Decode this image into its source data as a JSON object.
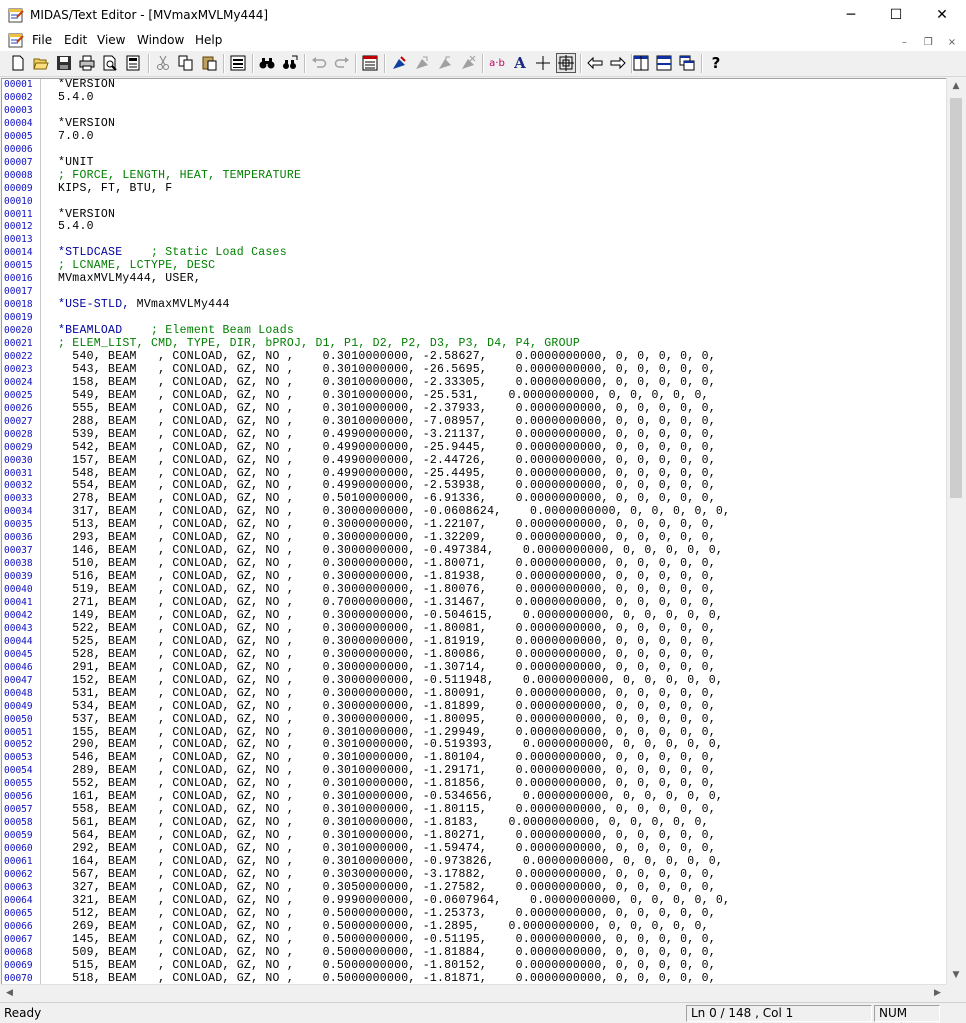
{
  "window": {
    "title": "MIDAS/Text Editor - [MVmaxMVLMy444]",
    "app_icon": "notepad-app-icon",
    "controls": {
      "minimize": "─",
      "maximize": "☐",
      "close": "✕"
    }
  },
  "menubar": {
    "items": [
      "File",
      "Edit",
      "View",
      "Window",
      "Help"
    ],
    "mdi_controls": {
      "minimize": "–",
      "restore": "❐",
      "close": "×"
    }
  },
  "toolbar": {
    "buttons": [
      {
        "name": "new-icon"
      },
      {
        "name": "open-icon"
      },
      {
        "name": "save-icon"
      },
      {
        "name": "print-icon"
      },
      {
        "name": "print-preview-icon"
      },
      {
        "name": "print-setup-icon"
      },
      {
        "name": "cut-icon"
      },
      {
        "name": "copy-icon"
      },
      {
        "name": "paste-icon"
      },
      {
        "name": "select-all-icon"
      },
      {
        "name": "find-icon"
      },
      {
        "name": "replace-icon"
      },
      {
        "name": "undo-icon"
      },
      {
        "name": "redo-icon"
      },
      {
        "name": "insert-command-icon"
      },
      {
        "name": "bookmark-toggle-icon"
      },
      {
        "name": "bookmark-next-icon"
      },
      {
        "name": "bookmark-prev-icon"
      },
      {
        "name": "bookmark-clear-icon"
      },
      {
        "name": "ab-format-icon",
        "label": "a·b"
      },
      {
        "name": "font-icon",
        "label": "A"
      },
      {
        "name": "crosshair-icon"
      },
      {
        "name": "column-mode-icon",
        "pressed": true
      },
      {
        "name": "arrow-left-icon"
      },
      {
        "name": "arrow-right-icon"
      },
      {
        "name": "tile-vertical-icon"
      },
      {
        "name": "tile-horizontal-icon"
      },
      {
        "name": "cascade-icon"
      },
      {
        "name": "help-icon",
        "label": "?"
      }
    ]
  },
  "editor": {
    "lines": [
      {
        "n": "00001",
        "t": "*VERSION",
        "k": "plain"
      },
      {
        "n": "00002",
        "t": "5.4.0",
        "k": "plain"
      },
      {
        "n": "00003",
        "t": "",
        "k": "plain"
      },
      {
        "n": "00004",
        "t": "*VERSION",
        "k": "plain"
      },
      {
        "n": "00005",
        "t": "7.0.0",
        "k": "plain"
      },
      {
        "n": "00006",
        "t": "",
        "k": "plain"
      },
      {
        "n": "00007",
        "t": "*UNIT",
        "k": "plain"
      },
      {
        "n": "00008",
        "t": "; FORCE, LENGTH, HEAT, TEMPERATURE",
        "k": "comment"
      },
      {
        "n": "00009",
        "t": "KIPS, FT, BTU, F",
        "k": "plain"
      },
      {
        "n": "00010",
        "t": "",
        "k": "plain"
      },
      {
        "n": "00011",
        "t": "*VERSION",
        "k": "plain"
      },
      {
        "n": "00012",
        "t": "5.4.0",
        "k": "plain"
      },
      {
        "n": "00013",
        "t": "",
        "k": "plain"
      },
      {
        "n": "00014",
        "t": "*STLDCASE",
        "c": "    ; Static Load Cases",
        "k": "cmd"
      },
      {
        "n": "00015",
        "t": "; LCNAME, LCTYPE, DESC",
        "k": "comment"
      },
      {
        "n": "00016",
        "t": "MVmaxMVLMy444, USER,",
        "k": "plain"
      },
      {
        "n": "00017",
        "t": "",
        "k": "plain"
      },
      {
        "n": "00018",
        "t": "*USE-STLD,",
        "r": " MVmaxMVLMy444",
        "k": "cmdrest"
      },
      {
        "n": "00019",
        "t": "",
        "k": "plain"
      },
      {
        "n": "00020",
        "t": "*BEAMLOAD",
        "c": "    ; Element Beam Loads",
        "k": "cmd"
      },
      {
        "n": "00021",
        "t": "; ELEM_LIST, CMD, TYPE, DIR, bPROJ, D1, P1, D2, P2, D3, P3, D4, P4, GROUP",
        "k": "comment"
      },
      {
        "n": "00022",
        "t": "  540, BEAM   , CONLOAD, GZ, NO ,    0.3010000000, -2.58627,    0.0000000000, 0, 0, 0, 0, 0,",
        "k": "plain"
      },
      {
        "n": "00023",
        "t": "  543, BEAM   , CONLOAD, GZ, NO ,    0.3010000000, -26.5695,    0.0000000000, 0, 0, 0, 0, 0,",
        "k": "plain"
      },
      {
        "n": "00024",
        "t": "  158, BEAM   , CONLOAD, GZ, NO ,    0.3010000000, -2.33305,    0.0000000000, 0, 0, 0, 0, 0,",
        "k": "plain"
      },
      {
        "n": "00025",
        "t": "  549, BEAM   , CONLOAD, GZ, NO ,    0.3010000000, -25.531,    0.0000000000, 0, 0, 0, 0, 0,",
        "k": "plain"
      },
      {
        "n": "00026",
        "t": "  555, BEAM   , CONLOAD, GZ, NO ,    0.3010000000, -2.37933,    0.0000000000, 0, 0, 0, 0, 0,",
        "k": "plain"
      },
      {
        "n": "00027",
        "t": "  288, BEAM   , CONLOAD, GZ, NO ,    0.3010000000, -7.08957,    0.0000000000, 0, 0, 0, 0, 0,",
        "k": "plain"
      },
      {
        "n": "00028",
        "t": "  539, BEAM   , CONLOAD, GZ, NO ,    0.4990000000, -3.21137,    0.0000000000, 0, 0, 0, 0, 0,",
        "k": "plain"
      },
      {
        "n": "00029",
        "t": "  542, BEAM   , CONLOAD, GZ, NO ,    0.4990000000, -25.9445,    0.0000000000, 0, 0, 0, 0, 0,",
        "k": "plain"
      },
      {
        "n": "00030",
        "t": "  157, BEAM   , CONLOAD, GZ, NO ,    0.4990000000, -2.44726,    0.0000000000, 0, 0, 0, 0, 0,",
        "k": "plain"
      },
      {
        "n": "00031",
        "t": "  548, BEAM   , CONLOAD, GZ, NO ,    0.4990000000, -25.4495,    0.0000000000, 0, 0, 0, 0, 0,",
        "k": "plain"
      },
      {
        "n": "00032",
        "t": "  554, BEAM   , CONLOAD, GZ, NO ,    0.4990000000, -2.53938,    0.0000000000, 0, 0, 0, 0, 0,",
        "k": "plain"
      },
      {
        "n": "00033",
        "t": "  278, BEAM   , CONLOAD, GZ, NO ,    0.5010000000, -6.91336,    0.0000000000, 0, 0, 0, 0, 0,",
        "k": "plain"
      },
      {
        "n": "00034",
        "t": "  317, BEAM   , CONLOAD, GZ, NO ,    0.3000000000, -0.0608624,    0.0000000000, 0, 0, 0, 0, 0,",
        "k": "plain"
      },
      {
        "n": "00035",
        "t": "  513, BEAM   , CONLOAD, GZ, NO ,    0.3000000000, -1.22107,    0.0000000000, 0, 0, 0, 0, 0,",
        "k": "plain"
      },
      {
        "n": "00036",
        "t": "  293, BEAM   , CONLOAD, GZ, NO ,    0.3000000000, -1.32209,    0.0000000000, 0, 0, 0, 0, 0,",
        "k": "plain"
      },
      {
        "n": "00037",
        "t": "  146, BEAM   , CONLOAD, GZ, NO ,    0.3000000000, -0.497384,    0.0000000000, 0, 0, 0, 0, 0,",
        "k": "plain"
      },
      {
        "n": "00038",
        "t": "  510, BEAM   , CONLOAD, GZ, NO ,    0.3000000000, -1.80071,    0.0000000000, 0, 0, 0, 0, 0,",
        "k": "plain"
      },
      {
        "n": "00039",
        "t": "  516, BEAM   , CONLOAD, GZ, NO ,    0.3000000000, -1.81938,    0.0000000000, 0, 0, 0, 0, 0,",
        "k": "plain"
      },
      {
        "n": "00040",
        "t": "  519, BEAM   , CONLOAD, GZ, NO ,    0.3000000000, -1.80076,    0.0000000000, 0, 0, 0, 0, 0,",
        "k": "plain"
      },
      {
        "n": "00041",
        "t": "  271, BEAM   , CONLOAD, GZ, NO ,    0.7000000000, -1.31467,    0.0000000000, 0, 0, 0, 0, 0,",
        "k": "plain"
      },
      {
        "n": "00042",
        "t": "  149, BEAM   , CONLOAD, GZ, NO ,    0.3000000000, -0.504615,    0.0000000000, 0, 0, 0, 0, 0,",
        "k": "plain"
      },
      {
        "n": "00043",
        "t": "  522, BEAM   , CONLOAD, GZ, NO ,    0.3000000000, -1.80081,    0.0000000000, 0, 0, 0, 0, 0,",
        "k": "plain"
      },
      {
        "n": "00044",
        "t": "  525, BEAM   , CONLOAD, GZ, NO ,    0.3000000000, -1.81919,    0.0000000000, 0, 0, 0, 0, 0,",
        "k": "plain"
      },
      {
        "n": "00045",
        "t": "  528, BEAM   , CONLOAD, GZ, NO ,    0.3000000000, -1.80086,    0.0000000000, 0, 0, 0, 0, 0,",
        "k": "plain"
      },
      {
        "n": "00046",
        "t": "  291, BEAM   , CONLOAD, GZ, NO ,    0.3000000000, -1.30714,    0.0000000000, 0, 0, 0, 0, 0,",
        "k": "plain"
      },
      {
        "n": "00047",
        "t": "  152, BEAM   , CONLOAD, GZ, NO ,    0.3000000000, -0.511948,    0.0000000000, 0, 0, 0, 0, 0,",
        "k": "plain"
      },
      {
        "n": "00048",
        "t": "  531, BEAM   , CONLOAD, GZ, NO ,    0.3000000000, -1.80091,    0.0000000000, 0, 0, 0, 0, 0,",
        "k": "plain"
      },
      {
        "n": "00049",
        "t": "  534, BEAM   , CONLOAD, GZ, NO ,    0.3000000000, -1.81899,    0.0000000000, 0, 0, 0, 0, 0,",
        "k": "plain"
      },
      {
        "n": "00050",
        "t": "  537, BEAM   , CONLOAD, GZ, NO ,    0.3000000000, -1.80095,    0.0000000000, 0, 0, 0, 0, 0,",
        "k": "plain"
      },
      {
        "n": "00051",
        "t": "  155, BEAM   , CONLOAD, GZ, NO ,    0.3010000000, -1.29949,    0.0000000000, 0, 0, 0, 0, 0,",
        "k": "plain"
      },
      {
        "n": "00052",
        "t": "  290, BEAM   , CONLOAD, GZ, NO ,    0.3010000000, -0.519393,    0.0000000000, 0, 0, 0, 0, 0,",
        "k": "plain"
      },
      {
        "n": "00053",
        "t": "  546, BEAM   , CONLOAD, GZ, NO ,    0.3010000000, -1.80104,    0.0000000000, 0, 0, 0, 0, 0,",
        "k": "plain"
      },
      {
        "n": "00054",
        "t": "  289, BEAM   , CONLOAD, GZ, NO ,    0.3010000000, -1.29171,    0.0000000000, 0, 0, 0, 0, 0,",
        "k": "plain"
      },
      {
        "n": "00055",
        "t": "  552, BEAM   , CONLOAD, GZ, NO ,    0.3010000000, -1.81856,    0.0000000000, 0, 0, 0, 0, 0,",
        "k": "plain"
      },
      {
        "n": "00056",
        "t": "  161, BEAM   , CONLOAD, GZ, NO ,    0.3010000000, -0.534656,    0.0000000000, 0, 0, 0, 0, 0,",
        "k": "plain"
      },
      {
        "n": "00057",
        "t": "  558, BEAM   , CONLOAD, GZ, NO ,    0.3010000000, -1.80115,    0.0000000000, 0, 0, 0, 0, 0,",
        "k": "plain"
      },
      {
        "n": "00058",
        "t": "  561, BEAM   , CONLOAD, GZ, NO ,    0.3010000000, -1.8183,    0.0000000000, 0, 0, 0, 0, 0,",
        "k": "plain"
      },
      {
        "n": "00059",
        "t": "  564, BEAM   , CONLOAD, GZ, NO ,    0.3010000000, -1.80271,    0.0000000000, 0, 0, 0, 0, 0,",
        "k": "plain"
      },
      {
        "n": "00060",
        "t": "  292, BEAM   , CONLOAD, GZ, NO ,    0.3010000000, -1.59474,    0.0000000000, 0, 0, 0, 0, 0,",
        "k": "plain"
      },
      {
        "n": "00061",
        "t": "  164, BEAM   , CONLOAD, GZ, NO ,    0.3010000000, -0.973826,    0.0000000000, 0, 0, 0, 0, 0,",
        "k": "plain"
      },
      {
        "n": "00062",
        "t": "  567, BEAM   , CONLOAD, GZ, NO ,    0.3030000000, -3.17882,    0.0000000000, 0, 0, 0, 0, 0,",
        "k": "plain"
      },
      {
        "n": "00063",
        "t": "  327, BEAM   , CONLOAD, GZ, NO ,    0.3050000000, -1.27582,    0.0000000000, 0, 0, 0, 0, 0,",
        "k": "plain"
      },
      {
        "n": "00064",
        "t": "  321, BEAM   , CONLOAD, GZ, NO ,    0.9990000000, -0.0607964,    0.0000000000, 0, 0, 0, 0, 0,",
        "k": "plain"
      },
      {
        "n": "00065",
        "t": "  512, BEAM   , CONLOAD, GZ, NO ,    0.5000000000, -1.25373,    0.0000000000, 0, 0, 0, 0, 0,",
        "k": "plain"
      },
      {
        "n": "00066",
        "t": "  269, BEAM   , CONLOAD, GZ, NO ,    0.5000000000, -1.2895,    0.0000000000, 0, 0, 0, 0, 0,",
        "k": "plain"
      },
      {
        "n": "00067",
        "t": "  145, BEAM   , CONLOAD, GZ, NO ,    0.5000000000, -0.51195,    0.0000000000, 0, 0, 0, 0, 0,",
        "k": "plain"
      },
      {
        "n": "00068",
        "t": "  509, BEAM   , CONLOAD, GZ, NO ,    0.5000000000, -1.81884,    0.0000000000, 0, 0, 0, 0, 0,",
        "k": "plain"
      },
      {
        "n": "00069",
        "t": "  515, BEAM   , CONLOAD, GZ, NO ,    0.5000000000, -1.80152,    0.0000000000, 0, 0, 0, 0, 0,",
        "k": "plain"
      },
      {
        "n": "00070",
        "t": "  518, BEAM   , CONLOAD, GZ, NO ,    0.5000000000, -1.81871,    0.0000000000, 0, 0, 0, 0, 0,",
        "k": "plain"
      }
    ]
  },
  "statusbar": {
    "status": "Ready",
    "position": "Ln 0 / 148 , Col 1",
    "num": "NUM"
  }
}
